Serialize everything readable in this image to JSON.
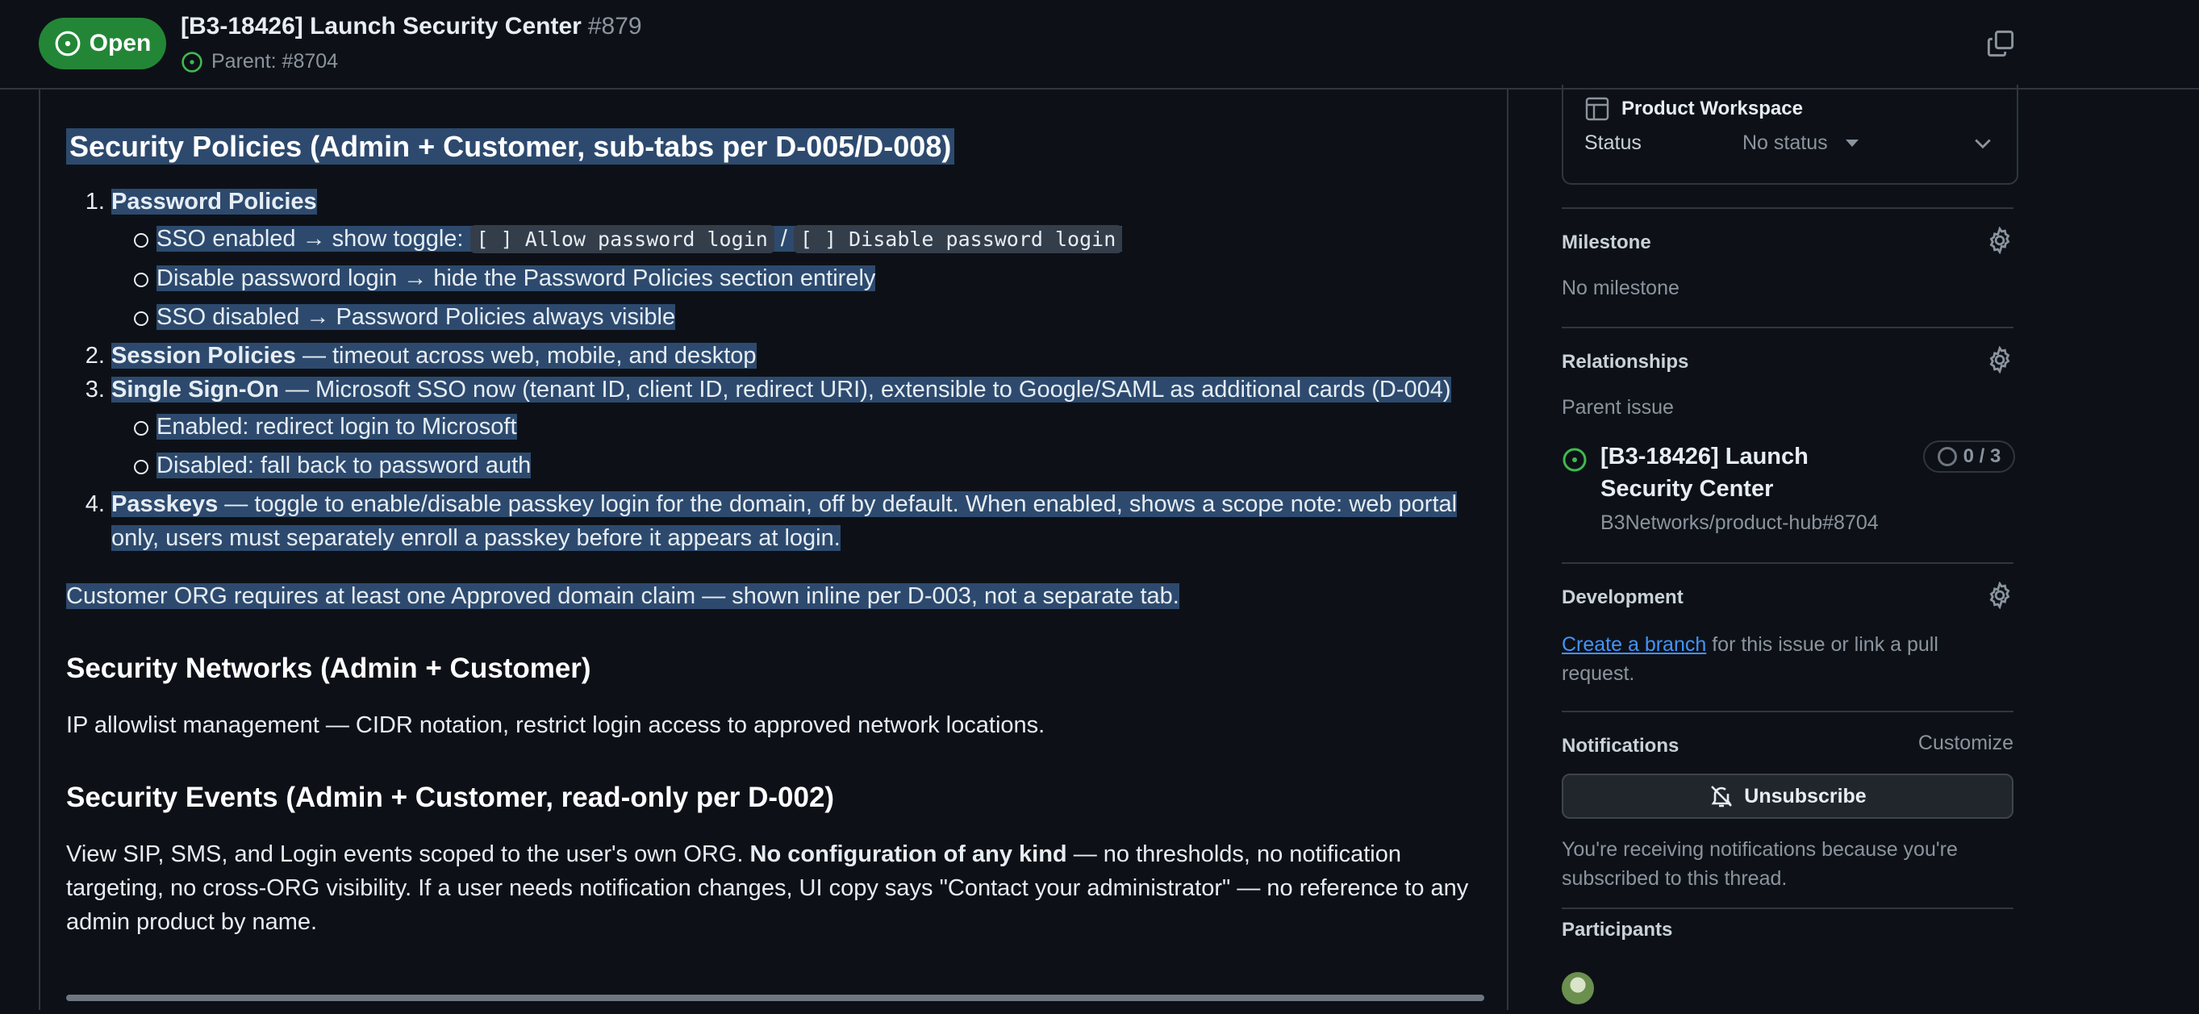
{
  "header": {
    "status_label": "Open",
    "title": "[B3-18426] Launch Security Center",
    "number": "#879",
    "parent_text": "Parent: #8704"
  },
  "body": {
    "h_policies": "Security Policies (Admin + Customer, sub-tabs per D-005/D-008)",
    "items": [
      {
        "bold": "Password Policies",
        "rest": "",
        "sub": [
          {
            "pre": "SSO enabled → show toggle: ",
            "code1": "[ ] Allow password login",
            "mid": " / ",
            "code2": "[ ] Disable password login"
          },
          {
            "text": "Disable password login → hide the Password Policies section entirely"
          },
          {
            "text": "SSO disabled → Password Policies always visible"
          }
        ]
      },
      {
        "bold": "Session Policies",
        "rest": " — timeout across web, mobile, and desktop"
      },
      {
        "bold": "Single Sign-On",
        "rest": " — Microsoft SSO now (tenant ID, client ID, redirect URI), extensible to Google/SAML as additional cards (D-004)",
        "sub": [
          {
            "text": "Enabled: redirect login to Microsoft"
          },
          {
            "text": "Disabled: fall back to password auth"
          }
        ]
      },
      {
        "bold": "Passkeys",
        "rest_a": " — toggle to enable/disable passkey login for the domain, off by default. When enabled, shows a scope note: web portal",
        "rest_b": "only, users must separately enroll a passkey before it appears at login."
      }
    ],
    "domain_note": "Customer ORG requires at least one Approved domain claim — shown inline per D-003, not a separate tab.",
    "h_networks": "Security Networks (Admin + Customer)",
    "networks_text": "IP allowlist management — CIDR notation, restrict login access to approved network locations.",
    "h_events": "Security Events (Admin + Customer, read-only per D-002)",
    "events_pre": "View SIP, SMS, and Login events scoped to the user's own ORG. ",
    "events_bold": "No configuration of any kind",
    "events_post_a": " — no thresholds, no notification",
    "events_line2": "targeting, no cross-ORG visibility. If a user needs notification changes, UI copy says \"Contact your administrator\" — no reference to any",
    "events_line3": "admin product by name."
  },
  "sidebar": {
    "workspace": {
      "title": "Product Workspace",
      "status_label": "Status",
      "status_value": "No status"
    },
    "milestone": {
      "title": "Milestone",
      "value": "No milestone"
    },
    "relationships": {
      "title": "Relationships",
      "parent_label": "Parent issue",
      "parent_title_1": "[B3-18426] Launch",
      "parent_title_2": "Security Center",
      "parent_repo": "B3Networks/product-hub#8704",
      "progress": "0 / 3"
    },
    "development": {
      "title": "Development",
      "link": "Create a branch",
      "text_a": " for this issue or link a pull",
      "text_b": "request."
    },
    "notifications": {
      "title": "Notifications",
      "customize": "Customize",
      "button": "Unsubscribe",
      "reason_1": "You're receiving notifications because you're",
      "reason_2": "subscribed to this thread."
    },
    "participants": {
      "title": "Participants"
    }
  },
  "colors": {
    "open_green": "#238636",
    "selection": "#2d4a6e",
    "link": "#4493f8"
  }
}
